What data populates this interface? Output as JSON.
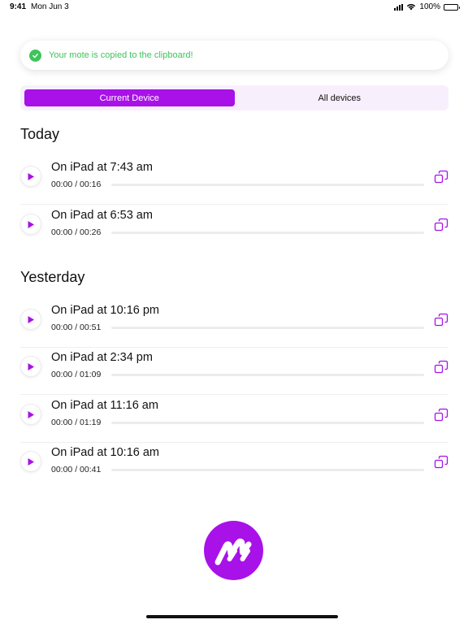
{
  "status_bar": {
    "time": "9:41",
    "date": "Mon Jun 3",
    "battery": "100%"
  },
  "toast": {
    "message": "Your mote is copied to the clipboard!"
  },
  "tabs": {
    "current_device": "Current Device",
    "all_devices": "All devices",
    "selected": "current_device"
  },
  "sections": [
    {
      "title": "Today",
      "items": [
        {
          "title": "On iPad at 7:43 am",
          "time": "00:00 / 00:16",
          "progress": 0
        },
        {
          "title": "On iPad at 6:53 am",
          "time": "00:00 / 00:26",
          "progress": 0
        }
      ]
    },
    {
      "title": "Yesterday",
      "items": [
        {
          "title": "On iPad at 10:16 pm",
          "time": "00:00 / 00:51",
          "progress": 0
        },
        {
          "title": "On iPad at 2:34 pm",
          "time": "00:00 / 01:09",
          "progress": 0
        },
        {
          "title": "On iPad at 11:16 am",
          "time": "00:00 / 01:19",
          "progress": 0
        },
        {
          "title": "On iPad at 10:16 am",
          "time": "00:00 / 00:41",
          "progress": 0
        }
      ]
    }
  ],
  "icons": {
    "play": "play-icon",
    "copy": "copy-icon",
    "toast": "checkmark-icon",
    "logo": "mote-logo-icon"
  },
  "colors": {
    "accent": "#a811e8",
    "success": "#3ec45a",
    "segment_bg": "#f8effd"
  }
}
